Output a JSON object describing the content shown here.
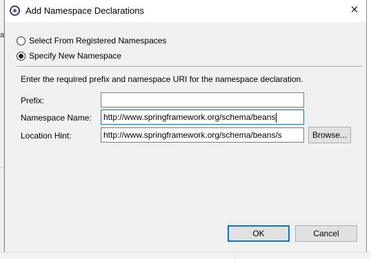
{
  "background": {
    "partial_char": "ac"
  },
  "dialog": {
    "title": "Add Namespace Declarations",
    "close_glyph": "✕"
  },
  "options": {
    "registered_label": "Select From Registered Namespaces",
    "new_label": "Specify New Namespace",
    "selected": "new"
  },
  "form": {
    "instructions": "Enter the required prefix and namespace URI for the namespace declaration.",
    "prefix_label": "Prefix:",
    "prefix_value": "",
    "namespace_label": "Namespace Name:",
    "namespace_value": "http://www.springframework.org/schema/beans",
    "location_label": "Location Hint:",
    "location_value": "http://www.springframework.org/schema/beans/s",
    "browse_label": "Browse..."
  },
  "buttons": {
    "ok_label": "OK",
    "cancel_label": "Cancel"
  },
  "colors": {
    "accent": "#0078d7",
    "dialog_bg": "#f0f0f0"
  }
}
